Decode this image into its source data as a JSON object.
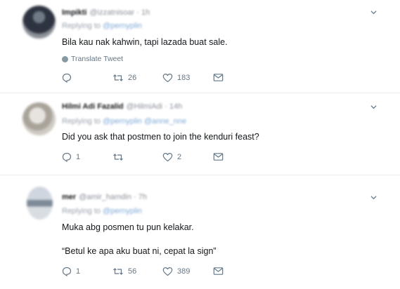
{
  "tweets": [
    {
      "name": "Impikti",
      "handle": "@izzatnisoar · 1h",
      "replying": "Replying to",
      "replying_to": "@pernyplin",
      "text_lines": [
        "Bila kau nak kahwin, tapi lazada buat sale."
      ],
      "translate": "Translate Tweet",
      "reply_count": "",
      "retweet_count": "26",
      "like_count": "183"
    },
    {
      "name": "Hilmi Adi Fazalid",
      "handle": "@HilmiAdi · 14h",
      "replying": "Replying to",
      "replying_to": "@pernyplin @anne_nne",
      "text_lines": [
        "Did you ask that postmen to join the kenduri feast?"
      ],
      "reply_count": "1",
      "retweet_count": "",
      "like_count": "2"
    },
    {
      "name": "mer",
      "handle": "@amir_hamdin · 7h",
      "replying": "Replying to",
      "replying_to": "@pernyplin",
      "text_lines": [
        "Muka abg posmen tu pun kelakar.",
        "“Betul ke apa aku buat ni, cepat la sign”"
      ],
      "reply_count": "1",
      "retweet_count": "56",
      "like_count": "389"
    }
  ],
  "icons": [
    "reply-icon",
    "retweet-icon",
    "like-icon",
    "message-icon",
    "chevron-down-icon",
    "globe-icon"
  ],
  "colors": {
    "text": "#14171a",
    "secondary": "#657786",
    "divider": "#e6ecf0",
    "link": "#1da1f2"
  }
}
